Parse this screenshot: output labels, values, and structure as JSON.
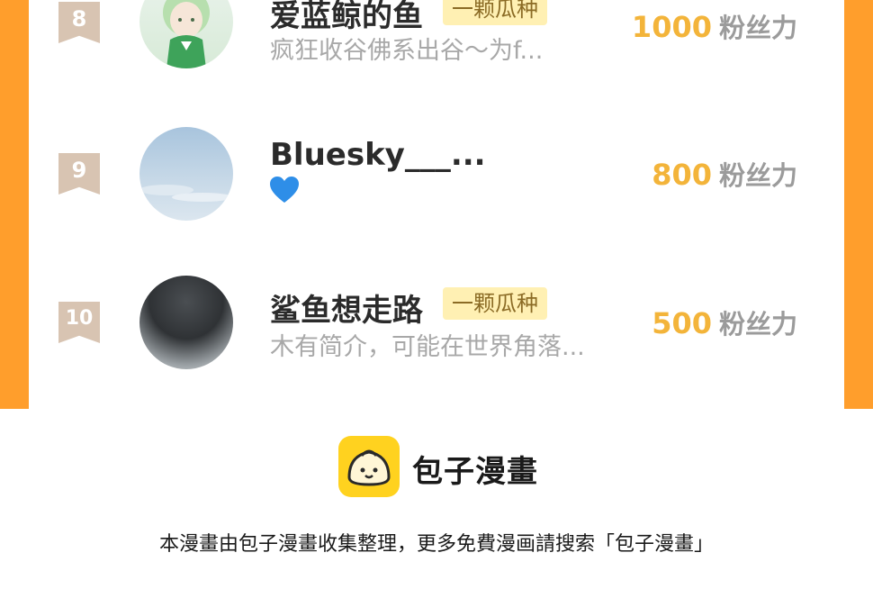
{
  "leaderboard": {
    "rows": [
      {
        "rank": "8",
        "name": "爱蓝鲸的鱼",
        "tag": "一颗瓜种",
        "desc": "疯狂收谷佛系出谷～为f...",
        "score": "1000",
        "unit": "粉丝力",
        "avatar_icon": "anime-character-avatar"
      },
      {
        "rank": "9",
        "name": "Bluesky___...",
        "tag": "",
        "desc": "",
        "emoji": "blue-heart-emoji",
        "score": "800",
        "unit": "粉丝力",
        "avatar_icon": "sky-avatar"
      },
      {
        "rank": "10",
        "name": "鲨鱼想走路",
        "tag": "一颗瓜种",
        "desc": "木有简介，可能在世界角落...",
        "score": "500",
        "unit": "粉丝力",
        "avatar_icon": "cloud-avatar"
      }
    ]
  },
  "footer": {
    "brand": "包子漫畫",
    "logo_icon": "bun-face-icon",
    "notice": "本漫畫由包子漫畫收集整理，更多免費漫画請搜索「包子漫畫」"
  },
  "colors": {
    "frame_orange": "#ff9e2c",
    "score_gold": "#f3b43a",
    "tag_bg": "#fff0b3",
    "badge_tan": "#d8c4b2",
    "logo_yellow": "#ffd21f"
  }
}
